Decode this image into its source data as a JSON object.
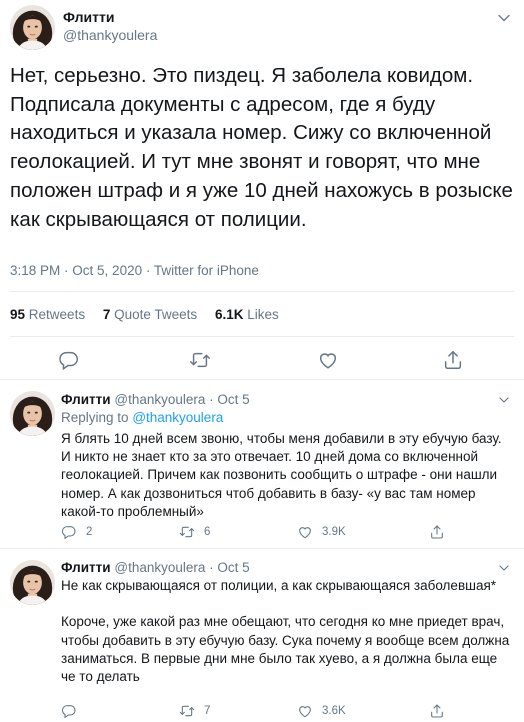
{
  "main": {
    "author_name": "Флитти",
    "author_handle": "@thankyoulera",
    "text": "Нет, серьезно. Это пиздец. Я заболела ковидом. Подписала документы с адресом, где я буду находиться и указала номер. Сижу со включенной геолокацией. И тут мне звонят и говорят, что мне положен штраф и я уже 10 дней нахожусь в розыске как скрывающаяся от полиции.",
    "time": "3:18 PM",
    "date": "Oct 5, 2020",
    "source": "Twitter for iPhone",
    "retweets_count": "95",
    "retweets_label": "Retweets",
    "quotes_count": "7",
    "quotes_label": "Quote Tweets",
    "likes_count": "6.1K",
    "likes_label": "Likes",
    "actions": [
      "reply-icon",
      "retweet-icon",
      "like-icon",
      "share-icon"
    ]
  },
  "replies": [
    {
      "author_name": "Флитти",
      "author_handle": "@thankyoulera",
      "date": "Oct 5",
      "replying_prefix": "Replying to",
      "replying_to": "@thankyoulera",
      "text": "Я блять 10 дней всем звоню, чтобы меня добавили в эту ебучую базу. И никто не знает кто за это отвечает. 10 дней дома со включенной геолокацией. Причем как позвонить сообщить о штрафе - они нашли номер. А как дозвониться чтоб добавить в базу- «у вас там номер какой-то проблемный»",
      "reply_count": "2",
      "retweet_count": "6",
      "like_count": "3.9K"
    },
    {
      "author_name": "Флитти",
      "author_handle": "@thankyoulera",
      "date": "Oct 5",
      "text": "Не как скрывающаяся от полиции, а как скрывающаяся заболевшая*\n\nКороче, уже какой раз мне обещают, что сегодня ко мне приедет врач, чтобы добавить в эту ебучую базу. Сука почему я вообще всем должна заниматься. В первые дни мне было так хуево, а я должна была еще че то делать",
      "reply_count": "",
      "retweet_count": "7",
      "like_count": "3.6K"
    }
  ],
  "colors": {
    "text": "#14171a",
    "secondary": "#657786",
    "link": "#1da1f2",
    "divider": "#e6ecf0"
  }
}
